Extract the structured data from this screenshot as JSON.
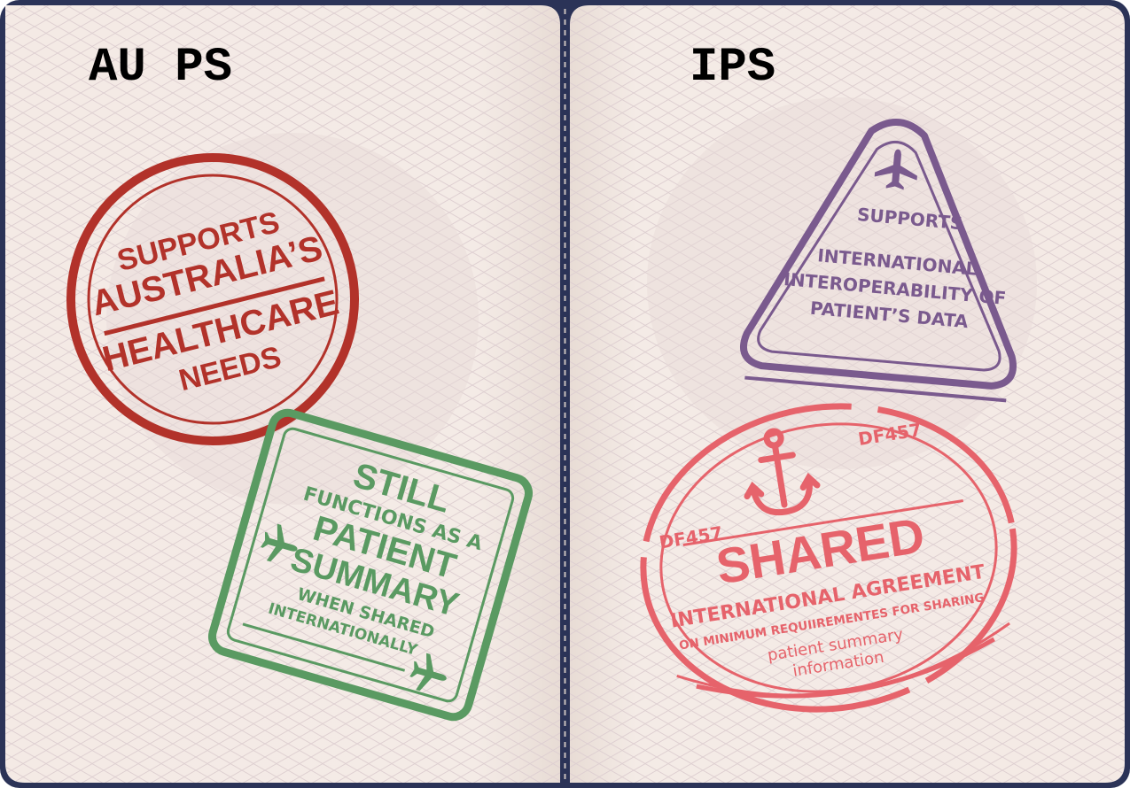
{
  "colors": {
    "cover": "#2b3357",
    "paper": "#f5ece6",
    "paper_shade": "#ece0d8",
    "guilloche": "#ddcfd0",
    "stamp_red": "#b2322a",
    "stamp_green": "#5a9a62",
    "stamp_purple": "#7a5a8e",
    "stamp_pink": "#e6636b"
  },
  "left_page": {
    "title": "AU PS",
    "round_stamp": {
      "line1": "SUPPORTS",
      "line2": "AUSTRALIA’S",
      "line3": "HEALTHCARE",
      "line4": "NEEDS"
    },
    "square_stamp": {
      "line1": "STILL",
      "line2": "FUNCTIONS AS A",
      "line3": "PATIENT",
      "line4": "SUMMARY",
      "line5": "WHEN SHARED",
      "line6": "INTERNATIONALLY",
      "icon": "airplane-icon"
    }
  },
  "right_page": {
    "title": "IPS",
    "triangle_stamp": {
      "line1": "SUPPORTS",
      "line2": "INTERNATIONAL",
      "line3": "INTEROPERABILITY OF",
      "line4": "PATIENT’S DATA",
      "icon": "airplane-icon"
    },
    "oval_stamp": {
      "code_left": "DF457",
      "code_right": "DF457",
      "line1": "SHARED",
      "line2": "INTERNATIONAL AGREEMENT",
      "line3": "ON MINIMUM REQUIIREMENTES FOR SHARING",
      "line4": "patient summary",
      "line5": "information",
      "icon": "anchor-icon"
    }
  }
}
